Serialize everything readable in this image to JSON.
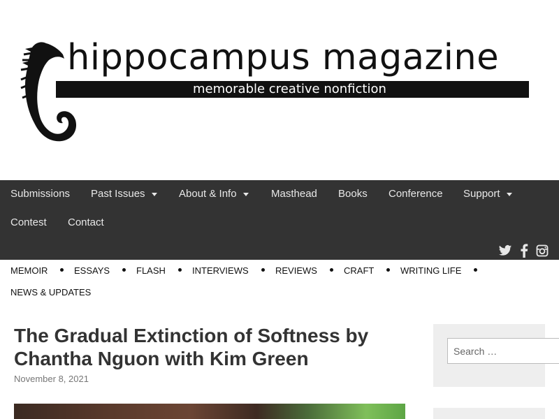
{
  "logo": {
    "title": "hippocampus magazine",
    "tagline": "memorable creative nonfiction"
  },
  "nav": {
    "items": [
      {
        "label": "Submissions",
        "dropdown": false
      },
      {
        "label": "Past Issues",
        "dropdown": true
      },
      {
        "label": "About & Info",
        "dropdown": true
      },
      {
        "label": "Masthead",
        "dropdown": false
      },
      {
        "label": "Books",
        "dropdown": false
      },
      {
        "label": "Conference",
        "dropdown": false
      },
      {
        "label": "Support",
        "dropdown": true
      },
      {
        "label": "Contest",
        "dropdown": false
      },
      {
        "label": "Contact",
        "dropdown": false
      }
    ],
    "social_icons": [
      "twitter-icon",
      "facebook-icon",
      "instagram-icon"
    ]
  },
  "categories": [
    "MEMOIR",
    "ESSAYS",
    "FLASH",
    "INTERVIEWS",
    "REVIEWS",
    "CRAFT",
    "WRITING LIFE",
    "NEWS & UPDATES"
  ],
  "post": {
    "title": "The Gradual Extinction of Softness by Chantha Nguon with Kim Green",
    "date": "November 8, 2021"
  },
  "sidebar": {
    "search_placeholder": "Search …"
  },
  "colors": {
    "nav_background": "#333333",
    "nav_text": "#e8e8e8",
    "widget_background": "#eeeeee"
  }
}
